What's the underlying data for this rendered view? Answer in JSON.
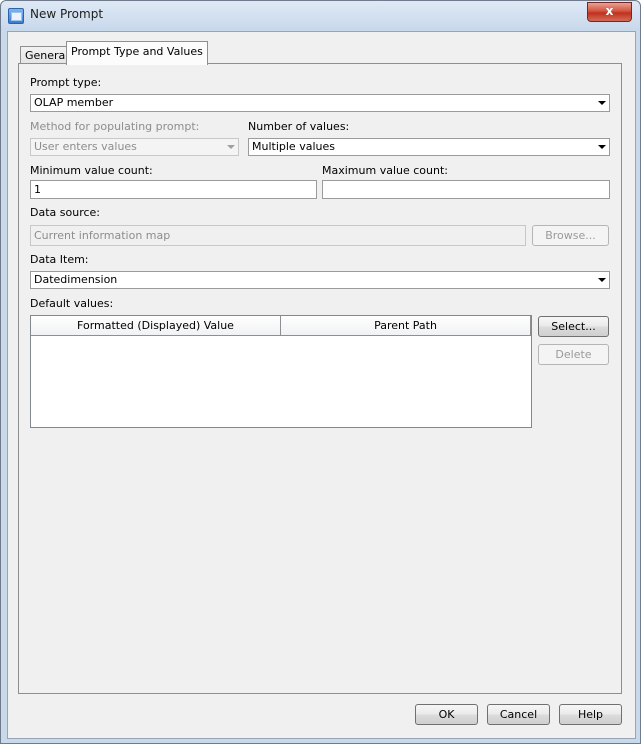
{
  "window": {
    "title": "New Prompt",
    "close_label": "x"
  },
  "tabs": [
    {
      "label": "General",
      "active": false
    },
    {
      "label": "Prompt Type and Values",
      "active": true
    }
  ],
  "form": {
    "prompt_type_label": "Prompt type:",
    "prompt_type_value": "OLAP member",
    "method_label": "Method for populating prompt:",
    "method_value": "User enters values",
    "num_values_label": "Number of values:",
    "num_values_value": "Multiple values",
    "min_count_label": "Minimum value count:",
    "min_count_value": "1",
    "max_count_label": "Maximum value count:",
    "max_count_value": "",
    "data_source_label": "Data source:",
    "data_source_value": "Current information map",
    "browse_label": "Browse...",
    "data_item_label": "Data Item:",
    "data_item_value": "Datedimension",
    "default_values_label": "Default values:"
  },
  "table": {
    "columns": [
      "Formatted (Displayed) Value",
      "Parent Path"
    ],
    "rows": []
  },
  "side_buttons": {
    "select_label": "Select...",
    "delete_label": "Delete"
  },
  "footer": {
    "ok_label": "OK",
    "cancel_label": "Cancel",
    "help_label": "Help"
  }
}
